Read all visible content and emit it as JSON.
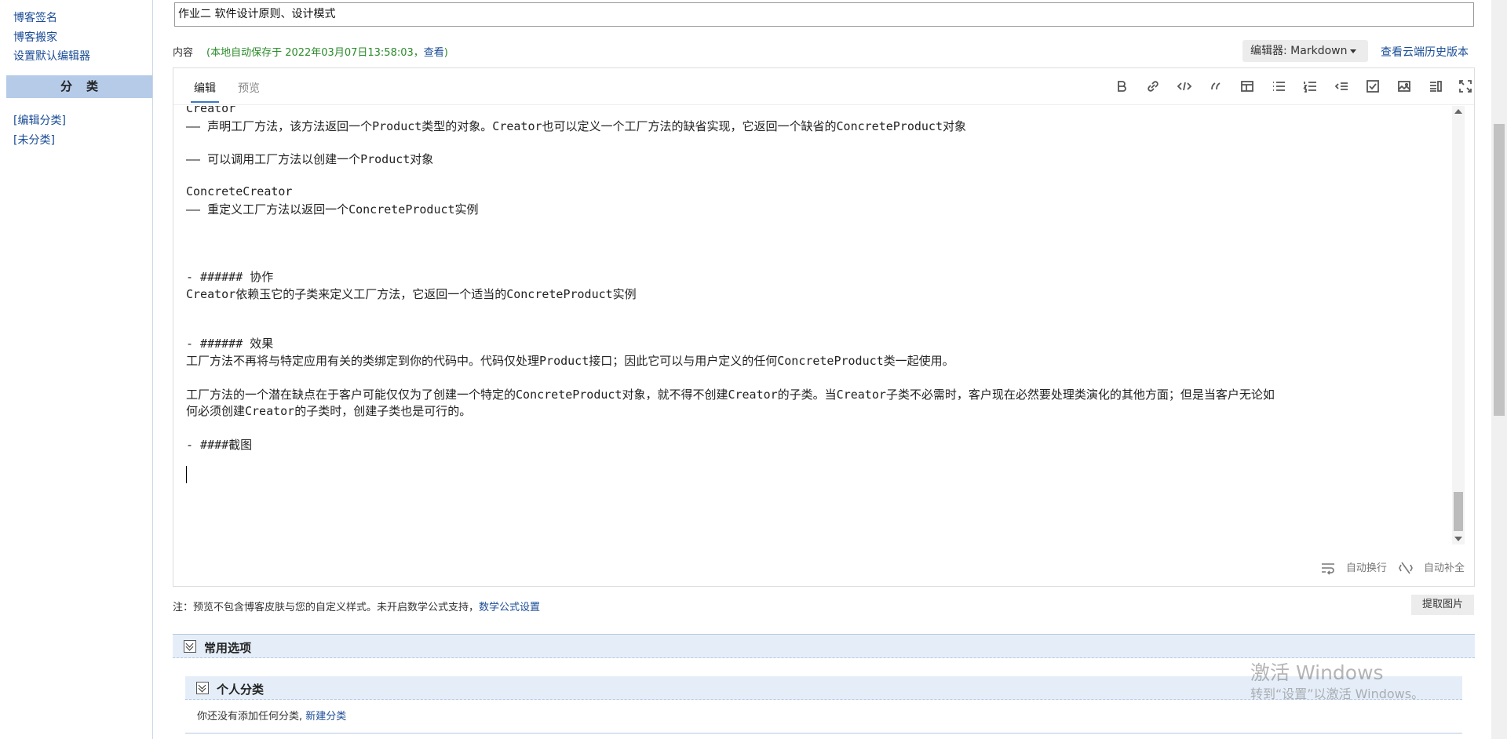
{
  "sidebar": {
    "links": [
      {
        "label": "博客签名"
      },
      {
        "label": "博客搬家"
      },
      {
        "label": "设置默认编辑器"
      }
    ],
    "category_header": "分类",
    "category_links": [
      {
        "label": "[编辑分类]"
      },
      {
        "label": "[未分类]"
      }
    ]
  },
  "title_input": {
    "value": "作业二 软件设计原则、设计模式"
  },
  "content_label": "内容",
  "autosave": {
    "prefix": "(本地自动保存于 2022年03月07日13:58:03，",
    "view_label": "查看",
    "suffix": ")"
  },
  "editor_select": {
    "label": "编辑器: Markdown"
  },
  "cloud_history": "查看云端历史版本",
  "tabs": [
    {
      "label": "编辑",
      "active": true
    },
    {
      "label": "预览",
      "active": false
    }
  ],
  "toolbar_icons": [
    "bold-icon",
    "link-icon",
    "code-icon",
    "quote-icon",
    "table-icon",
    "unordered-list-icon",
    "ordered-list-icon",
    "indent-icon",
    "checkbox-icon",
    "image-icon",
    "split-view-icon",
    "fullscreen-icon"
  ],
  "editor_lines": [
    "Creator",
    "—— 声明工厂方法，该方法返回一个Product类型的对象。Creator也可以定义一个工厂方法的缺省实现，它返回一个缺省的ConcreteProduct对象",
    "—— 可以调用工厂方法以创建一个Product对象",
    "ConcreteCreator",
    "—— 重定义工厂方法以返回一个ConcreteProduct实例",
    "- ###### 协作",
    "Creator依赖玉它的子类来定义工厂方法，它返回一个适当的ConcreteProduct实例",
    "- ###### 效果",
    "工厂方法不再将与特定应用有关的类绑定到你的代码中。代码仅处理Product接口；因此它可以与用户定义的任何ConcreteProduct类一起使用。",
    "工厂方法的一个潜在缺点在于客户可能仅仅为了创建一个特定的ConcreteProduct对象，就不得不创建Creator的子类。当Creator子类不必需时，客户现在必然要处理类演化的其他方面；但是当客户无论如",
    "何必须创建Creator的子类时，创建子类也是可行的。",
    "- ####截图"
  ],
  "editor_footer": {
    "word_wrap": "自动换行",
    "auto_complete": "自动补全"
  },
  "note": {
    "text": "注：预览不包含博客皮肤与您的自定义样式。未开启数学公式支持，",
    "link": "数学公式设置"
  },
  "extract_button": "提取图片",
  "common_options_title": "常用选项",
  "personal_category": {
    "title": "个人分类",
    "empty_text": "你还没有添加任何分类,",
    "new_link": "新建分类"
  },
  "watermark": {
    "line1": "激活 Windows",
    "line2": "转到“设置”以激活 Windows。"
  }
}
